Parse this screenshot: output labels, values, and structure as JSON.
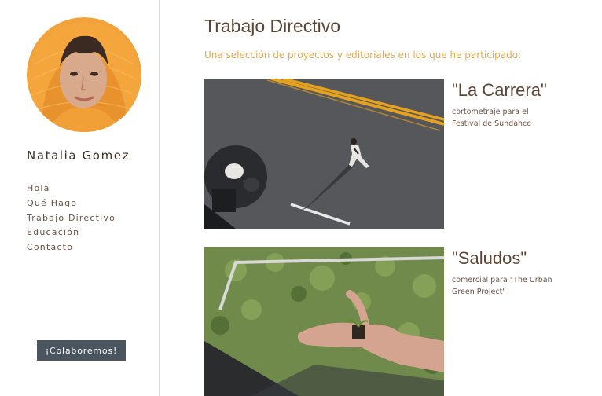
{
  "profile": {
    "name": "Natalia Gomez"
  },
  "nav": {
    "items": [
      {
        "label": "Hola"
      },
      {
        "label": "Qué Hago"
      },
      {
        "label": "Trabajo Directivo"
      },
      {
        "label": "Educación"
      },
      {
        "label": "Contacto"
      }
    ]
  },
  "cta": {
    "label": "¡Colaboremos!"
  },
  "page": {
    "title": "Trabajo Directivo",
    "subtitle": "Una selección de proyectos y editoriales en los que he participado:"
  },
  "projects": [
    {
      "title": "\"La Carrera\"",
      "description": "cortometraje para el Festival de Sundance"
    },
    {
      "title": "\"Saludos\"",
      "description": "comercial para \"The Urban Green Project\""
    }
  ],
  "colors": {
    "accent": "#e0aa52",
    "button_bg": "#4a5560",
    "text_dark": "#5b4636"
  }
}
